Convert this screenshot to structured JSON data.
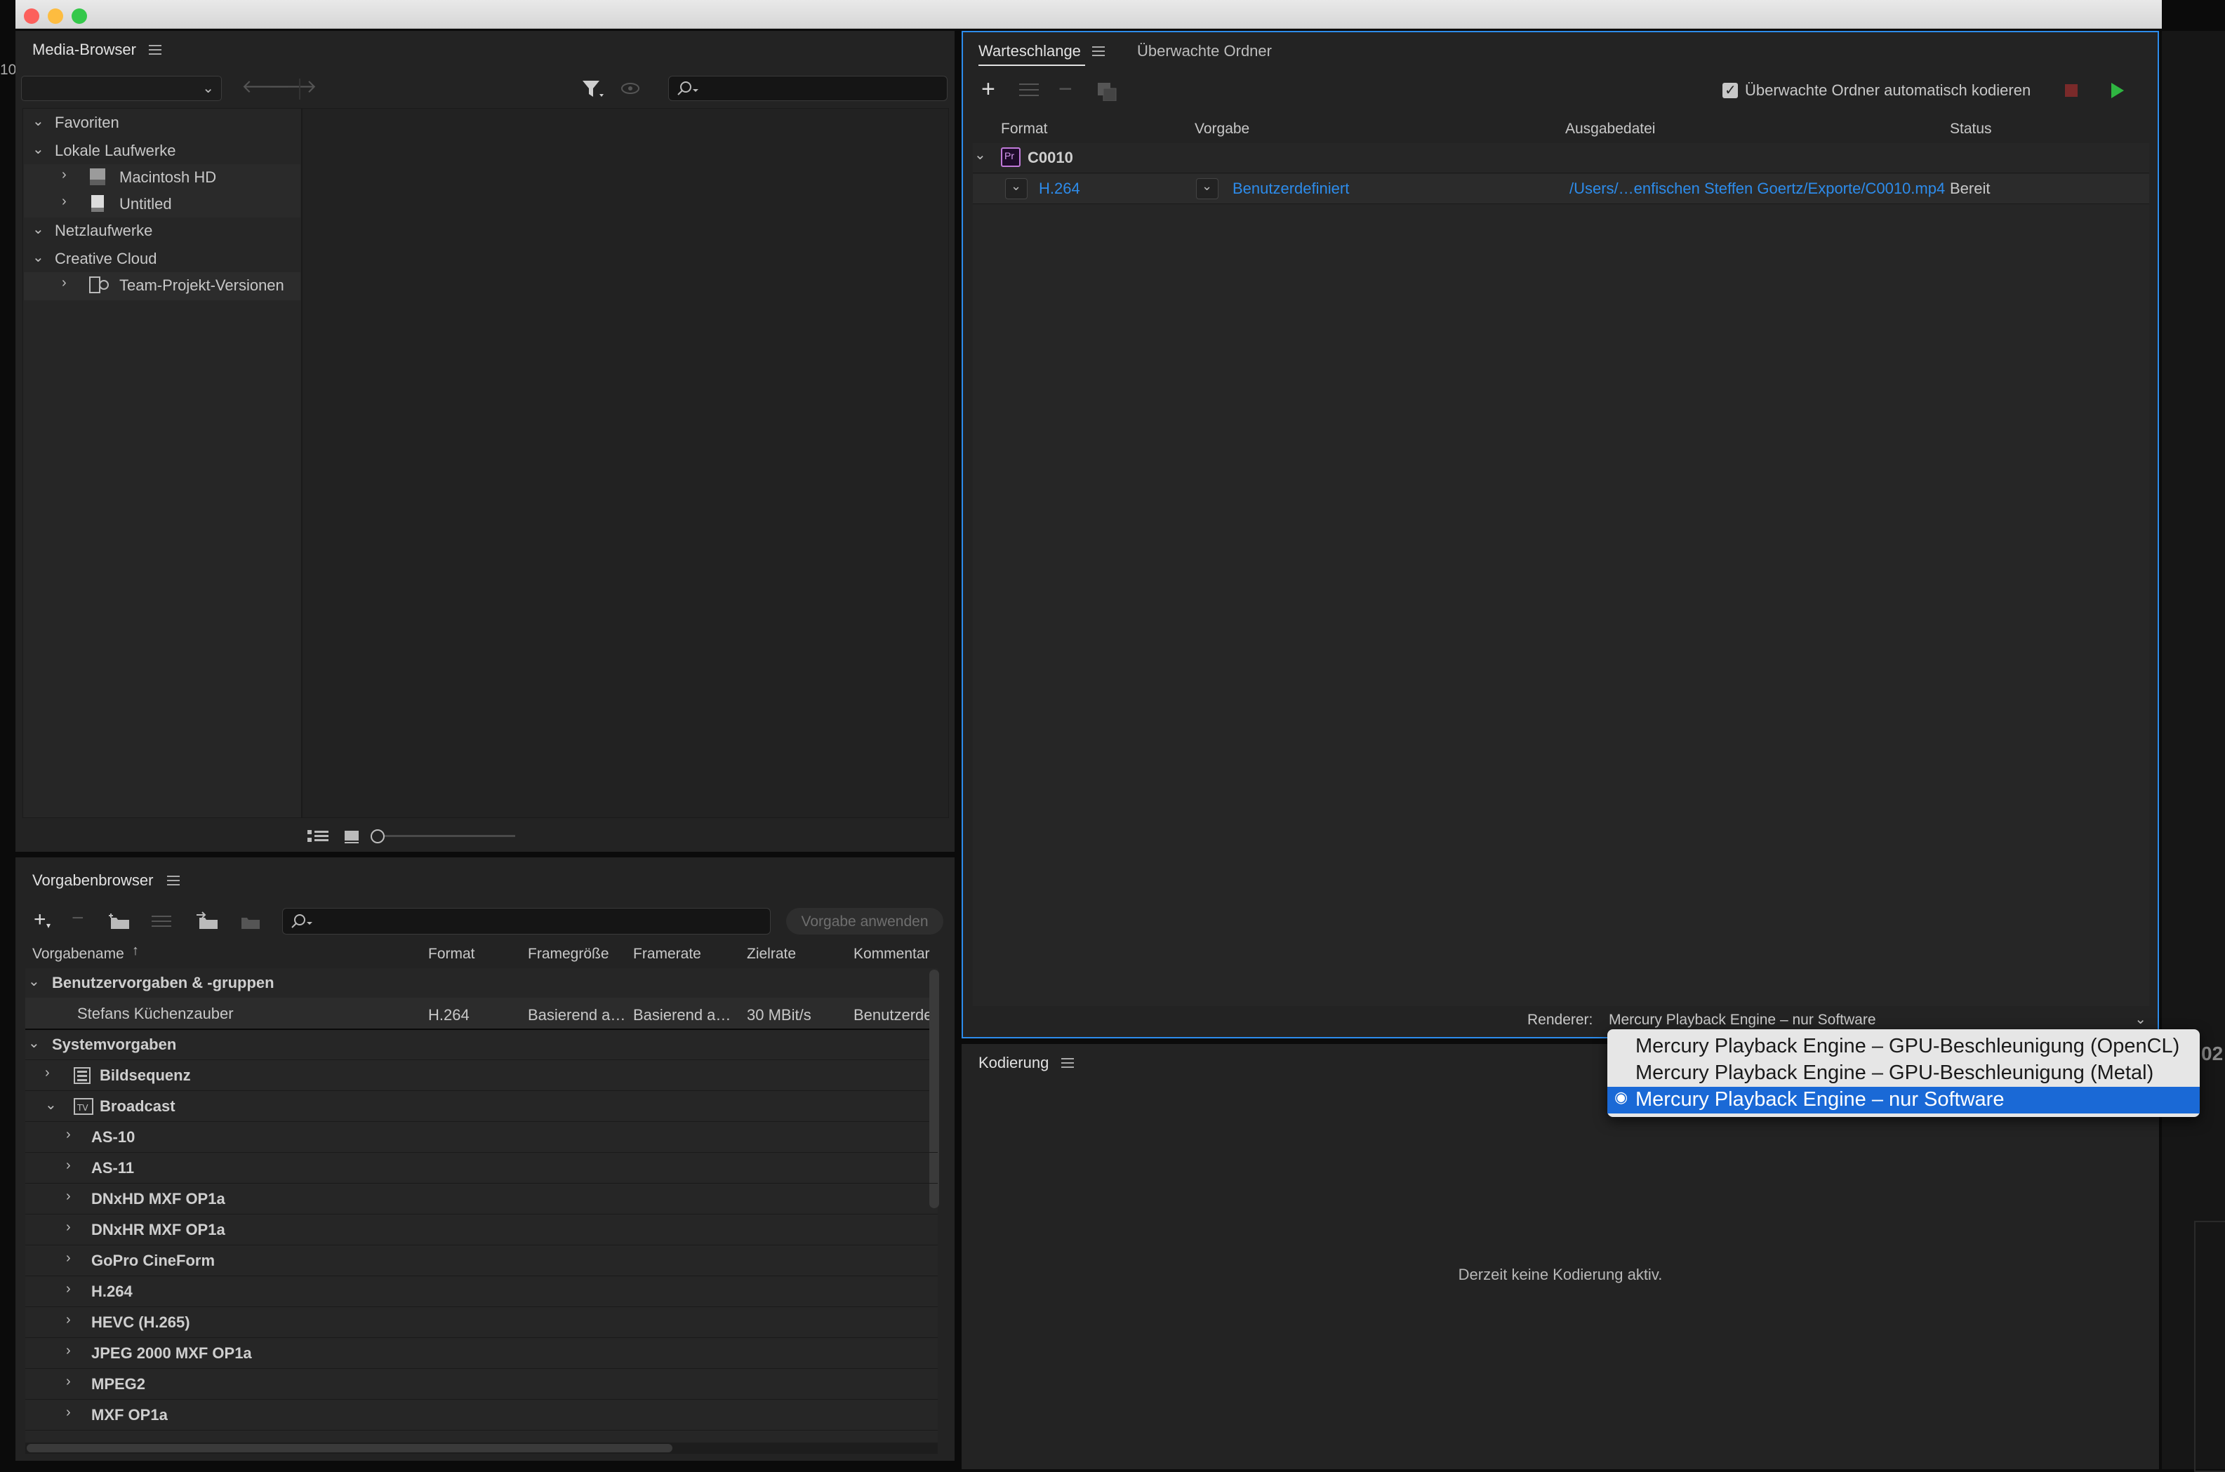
{
  "media_browser": {
    "title": "Media-Browser",
    "tree": {
      "favoriten": "Favoriten",
      "lokale": "Lokale Laufwerke",
      "macintosh": "Macintosh HD",
      "untitled": "Untitled",
      "netz": "Netzlaufwerke",
      "cc": "Creative Cloud",
      "team": "Team-Projekt-Versionen"
    }
  },
  "queue": {
    "tab_active": "Warteschlange",
    "tab_inactive": "Überwachte Ordner",
    "auto_encode_label": "Überwachte Ordner automatisch kodieren",
    "auto_encode_checked": true,
    "columns": [
      "Format",
      "Vorgabe",
      "Ausgabedatei",
      "Status"
    ],
    "group_name": "C0010",
    "group_icon_text": "Pr",
    "item": {
      "format": "H.264",
      "preset": "Benutzerdefiniert",
      "output": "/Users/…enfischen Steffen Goertz/Exporte/C0010.mp4",
      "status": "Bereit"
    },
    "renderer_label": "Renderer:",
    "renderer_value": "Mercury Playback Engine – nur Software"
  },
  "renderer_menu": {
    "options": [
      "Mercury Playback Engine – GPU-Beschleunigung (OpenCL)",
      "Mercury Playback Engine – GPU-Beschleunigung (Metal)",
      "Mercury Playback Engine – nur Software"
    ],
    "selected_index": 2
  },
  "encoding": {
    "title": "Kodierung",
    "empty_message": "Derzeit keine Kodierung aktiv."
  },
  "preset_browser": {
    "title": "Vorgabenbrowser",
    "apply_button": "Vorgabe anwenden",
    "columns": [
      "Vorgabename",
      "Format",
      "Framegröße",
      "Framerate",
      "Zielrate",
      "Kommentar"
    ],
    "user_group": "Benutzervorgaben & -gruppen",
    "user_preset": {
      "name": "Stefans Küchenzauber",
      "format": "H.264",
      "framesize": "Basierend a…",
      "framerate": "Basierend a…",
      "bitrate": "30 MBit/s",
      "comment": "Benutzerde"
    },
    "system_group": "Systemvorgaben",
    "bildsequenz": "Bildsequenz",
    "broadcast": "Broadcast",
    "broadcast_items": [
      "AS-10",
      "AS-11",
      "DNxHD MXF OP1a",
      "DNxHR MXF OP1a",
      "GoPro CineForm",
      "H.264",
      "HEVC (H.265)",
      "JPEG 2000 MXF OP1a",
      "MPEG2",
      "MXF OP1a"
    ]
  },
  "edge": {
    "left_fragment": "10",
    "right_fragment": "02"
  },
  "colors": {
    "accent_blue": "#2d8ceb",
    "play_green": "#2fb541",
    "stop_red": "#7a2a2a",
    "selection": "#1a69d6"
  }
}
